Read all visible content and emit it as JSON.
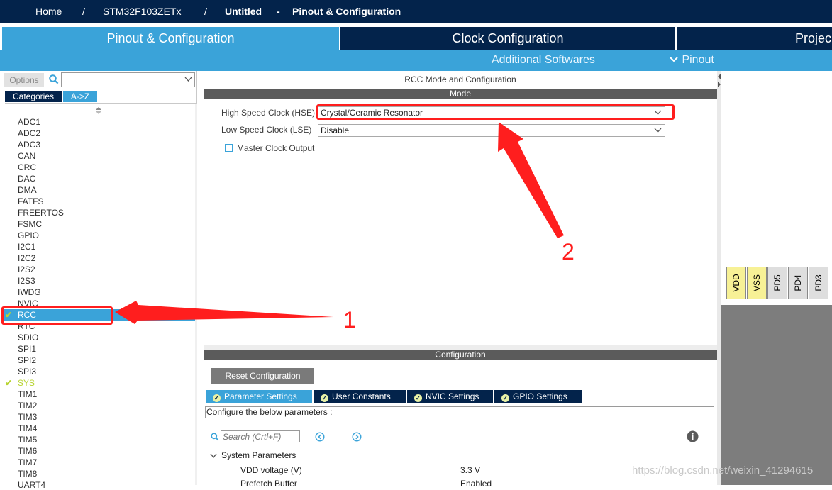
{
  "breadcrumb": {
    "home": "Home",
    "sep": "/",
    "device": "STM32F103ZETx",
    "project": "Untitled",
    "dash": "-",
    "view": "Pinout & Configuration"
  },
  "main_tabs": [
    {
      "label": "Pinout & Configuration"
    },
    {
      "label": "Clock Configuration"
    },
    {
      "label": "Projec"
    }
  ],
  "subbar": {
    "additional": "Additional Softwares",
    "pinout": "Pinout",
    "pinout_icon": "chevron-down-icon"
  },
  "left": {
    "options_label": "Options",
    "search_value": "",
    "categories_label": "Categories",
    "az_label": "A->Z",
    "items": [
      "ADC1",
      "ADC2",
      "ADC3",
      "CAN",
      "CRC",
      "DAC",
      "DMA",
      "FATFS",
      "FREERTOS",
      "FSMC",
      "GPIO",
      "I2C1",
      "I2C2",
      "I2S2",
      "I2S3",
      "IWDG",
      "NVIC",
      "RCC",
      "RTC",
      "SDIO",
      "SPI1",
      "SPI2",
      "SPI3",
      "SYS",
      "TIM1",
      "TIM2",
      "TIM3",
      "TIM4",
      "TIM5",
      "TIM6",
      "TIM7",
      "TIM8",
      "UART4"
    ],
    "selected": "RCC",
    "checked": [
      "RCC",
      "SYS"
    ]
  },
  "mode": {
    "title": "RCC Mode and Configuration",
    "header": "Mode",
    "hse_label": "High Speed Clock (HSE)",
    "hse_value": "Crystal/Ceramic Resonator",
    "lse_label": "Low Speed Clock (LSE)",
    "lse_value": "Disable",
    "mco_label": "Master Clock Output",
    "mco_checked": false
  },
  "config": {
    "header": "Configuration",
    "reset_button": "Reset Configuration",
    "tabs": [
      "Parameter Settings",
      "User Constants",
      "NVIC Settings",
      "GPIO Settings"
    ],
    "configure_text": "Configure the below parameters :",
    "search_placeholder": "Search (Crtl+F)",
    "group": "System Parameters",
    "params": [
      {
        "name": "VDD voltage (V)",
        "value": "3.3 V"
      },
      {
        "name": "Prefetch Buffer",
        "value": "Enabled"
      }
    ]
  },
  "pins": [
    "VDD",
    "VSS",
    "PD5",
    "PD4",
    "PD3"
  ],
  "annotations": {
    "one": "1",
    "two": "2"
  },
  "watermark": "https://blog.csdn.net/weixin_41294615",
  "colors": {
    "navy": "#03234b",
    "blue": "#3aa3d9",
    "red": "#ff1e1e",
    "check": "#b8d432"
  }
}
